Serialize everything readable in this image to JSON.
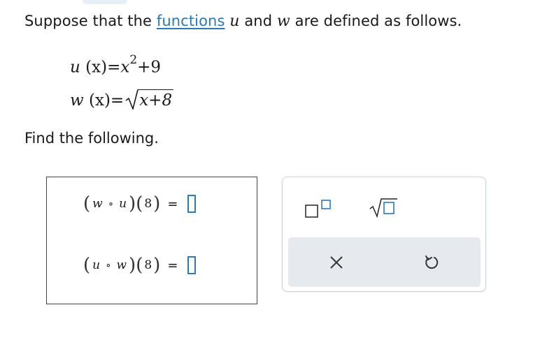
{
  "prompt": {
    "before": "Suppose that the ",
    "link": "functions",
    "mid1": " ",
    "var_u": "u",
    "mid2": " and ",
    "var_w": "w",
    "after": " are defined as follows."
  },
  "definitions": {
    "u": {
      "name": "u",
      "arg": "(x)",
      "eq": "=",
      "base": "x",
      "exp": "2",
      "rest": "+9"
    },
    "w": {
      "name": "w",
      "arg": "(x)",
      "eq": "=",
      "radicand": "x+8"
    }
  },
  "instruction": "Find the following.",
  "questions": [
    {
      "outer": "w",
      "op": "∘",
      "inner": "u",
      "arg": "8",
      "eq": "=",
      "answer": ""
    },
    {
      "outer": "u",
      "op": "∘",
      "inner": "w",
      "arg": "8",
      "eq": "=",
      "answer": ""
    }
  ],
  "toolbar": {
    "superscript_icon": "superscript-template-icon",
    "sqrt_icon": "square-root-template-icon",
    "clear_icon": "clear-x-icon",
    "undo_icon": "undo-icon"
  },
  "colors": {
    "accent": "#2a7ab8",
    "panel_footer": "#e6eaee",
    "text": "#1a1a1a"
  }
}
